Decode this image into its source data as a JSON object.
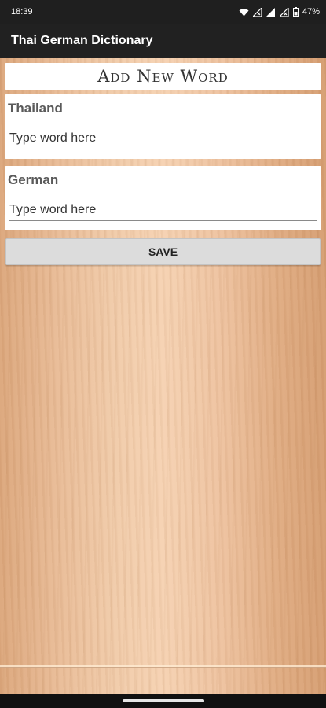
{
  "status_bar": {
    "time": "18:39",
    "battery_percent": "47%",
    "icons": [
      "wifi-icon",
      "signal-x-icon",
      "signal-icon",
      "signal-x-icon",
      "battery-icon"
    ]
  },
  "app_bar": {
    "title": "Thai German Dictionary"
  },
  "form": {
    "heading": "Add New Word",
    "thai_label": "Thailand",
    "thai_placeholder": "Type word here",
    "german_label": "German",
    "german_placeholder": "Type word here",
    "save_label": "SAVE"
  },
  "colors": {
    "app_bar": "#212121",
    "button": "#dcdcdc",
    "wood_light": "#f6d2b2",
    "wood_dark": "#d69e72"
  }
}
